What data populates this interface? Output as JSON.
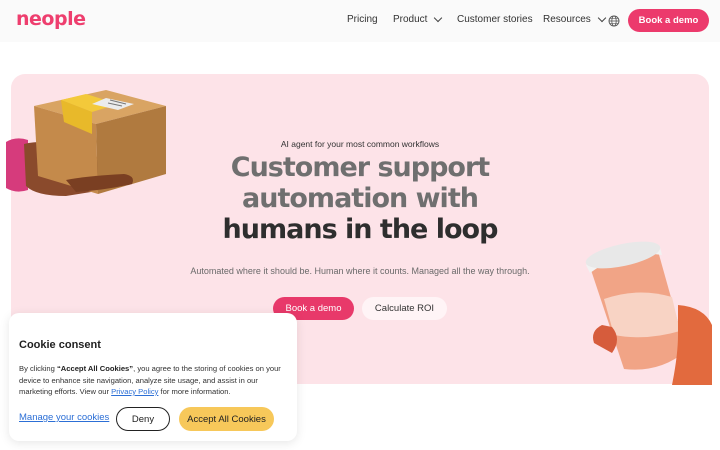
{
  "brand": {
    "logo_text": "neople",
    "accent": "#ec3a6c"
  },
  "nav": {
    "items": [
      {
        "label": "Pricing"
      },
      {
        "label": "Product",
        "has_dropdown": true
      },
      {
        "label": "Customer stories"
      },
      {
        "label": "Resources",
        "has_dropdown": true
      }
    ],
    "language_icon": "globe-icon",
    "cta_label": "Book a demo"
  },
  "hero": {
    "kicker": "AI agent for your most common workflows",
    "headline_line1": "Customer support",
    "headline_line2": "automation with",
    "headline_line3": "humans in the loop",
    "subtitle": "Automated where it should be. Human where it counts. Managed all the way through.",
    "primary_cta": "Book a demo",
    "secondary_cta": "Calculate ROI",
    "background": "#fde3e8"
  },
  "cookie": {
    "title": "Cookie consent",
    "text_before": "By clicking ",
    "text_bold": "“Accept All Cookies”",
    "text_after": ", you agree to the storing of cookies on your device to enhance site navigation, analyze site usage, and assist in our marketing efforts. View our ",
    "privacy_link": "Privacy Policy",
    "text_end": " for more information.",
    "manage_label": "Manage your cookies",
    "deny_label": "Deny",
    "accept_label": "Accept All Cookies",
    "accept_color": "#f7c85a"
  }
}
